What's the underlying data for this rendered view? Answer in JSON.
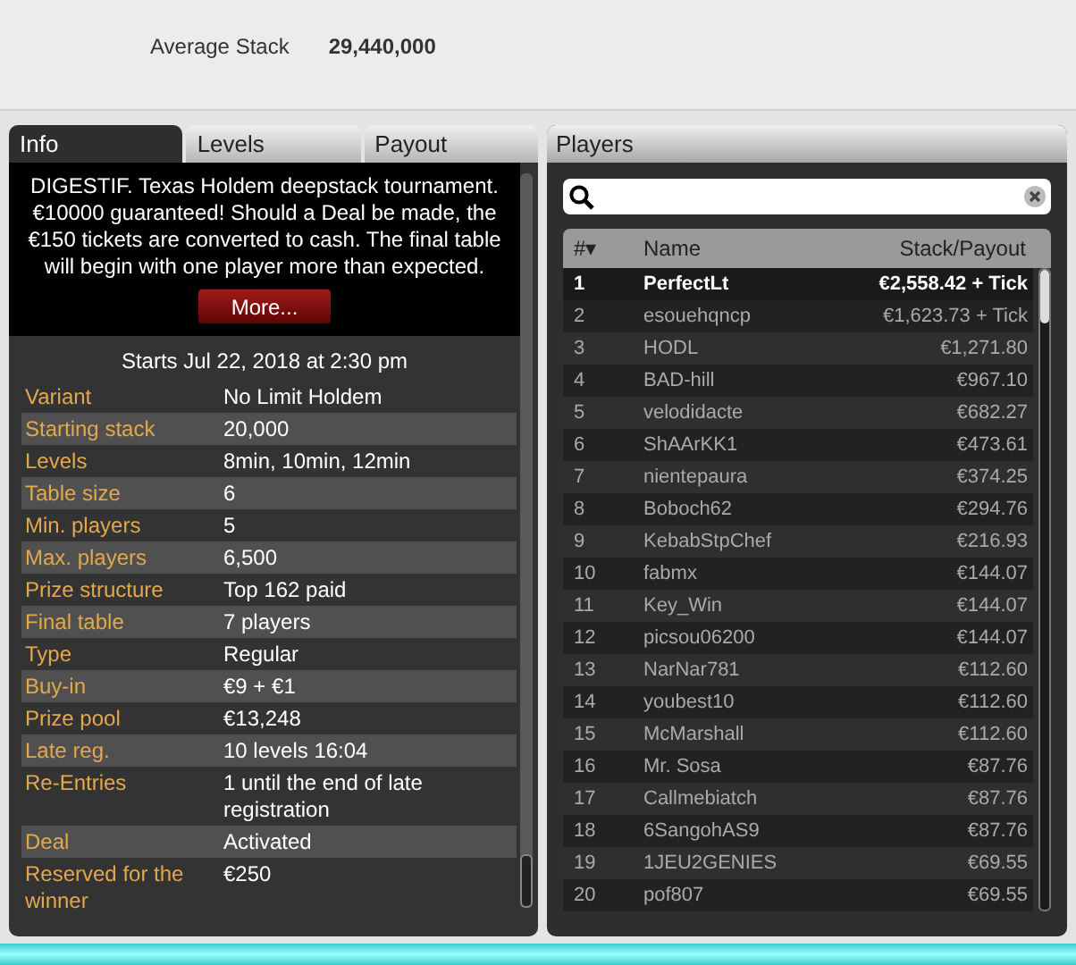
{
  "summary": {
    "label": "Average Stack",
    "value": "29,440,000"
  },
  "tabs": [
    {
      "label": "Info",
      "selected": true
    },
    {
      "label": "Levels",
      "selected": false
    },
    {
      "label": "Payout",
      "selected": false
    }
  ],
  "description": "DIGESTIF. Texas Holdem deepstack tournament. €10000 guaranteed! Should a Deal be made, the €150 tickets are converted to cash. The final table will begin with one player more than expected.",
  "more_button": "More...",
  "start": "Starts Jul 22, 2018 at 2:30 pm",
  "details": [
    {
      "label": "Variant",
      "value": "No Limit Holdem"
    },
    {
      "label": "Starting stack",
      "value": "20,000"
    },
    {
      "label": "Levels",
      "value": "8min, 10min, 12min"
    },
    {
      "label": "Table size",
      "value": "6"
    },
    {
      "label": "Min. players",
      "value": "5"
    },
    {
      "label": "Max. players",
      "value": "6,500"
    },
    {
      "label": "Prize structure",
      "value": "Top 162 paid"
    },
    {
      "label": "Final table",
      "value": "7 players"
    },
    {
      "label": "Type",
      "value": "Regular"
    },
    {
      "label": "Buy-in",
      "value": "€9 + €1"
    },
    {
      "label": "Prize pool",
      "value": "€13,248"
    },
    {
      "label": "Late reg.",
      "value": "10 levels 16:04"
    },
    {
      "label": "Re-Entries",
      "value": "1 until the end of late registration"
    },
    {
      "label": "Deal",
      "value": "Activated"
    },
    {
      "label": "Reserved for the winner",
      "value": "€250"
    }
  ],
  "players_panel": {
    "title": "Players",
    "columns": [
      "#▾",
      "Name",
      "Stack/Payout"
    ],
    "rows": [
      {
        "rank": "1",
        "name": "PerfectLt",
        "payout": "€2,558.42 +  Tick",
        "selected": true
      },
      {
        "rank": "2",
        "name": "esouehqncp",
        "payout": "€1,623.73 +  Tick",
        "selected": false
      },
      {
        "rank": "3",
        "name": "HODL",
        "payout": "€1,271.80",
        "selected": false
      },
      {
        "rank": "4",
        "name": "BAD-hill",
        "payout": "€967.10",
        "selected": false
      },
      {
        "rank": "5",
        "name": "velodidacte",
        "payout": "€682.27",
        "selected": false
      },
      {
        "rank": "6",
        "name": "ShAArKK1",
        "payout": "€473.61",
        "selected": false
      },
      {
        "rank": "7",
        "name": "nientepaura",
        "payout": "€374.25",
        "selected": false
      },
      {
        "rank": "8",
        "name": "Boboch62",
        "payout": "€294.76",
        "selected": false
      },
      {
        "rank": "9",
        "name": "KebabStpChef",
        "payout": "€216.93",
        "selected": false
      },
      {
        "rank": "10",
        "name": "fabmx",
        "payout": "€144.07",
        "selected": false
      },
      {
        "rank": "11",
        "name": "Key_Win",
        "payout": "€144.07",
        "selected": false
      },
      {
        "rank": "12",
        "name": "picsou06200",
        "payout": "€144.07",
        "selected": false
      },
      {
        "rank": "13",
        "name": "NarNar781",
        "payout": "€112.60",
        "selected": false
      },
      {
        "rank": "14",
        "name": "youbest10",
        "payout": "€112.60",
        "selected": false
      },
      {
        "rank": "15",
        "name": "McMarshall",
        "payout": "€112.60",
        "selected": false
      },
      {
        "rank": "16",
        "name": "Mr. Sosa",
        "payout": "€87.76",
        "selected": false
      },
      {
        "rank": "17",
        "name": "Callmebiatch",
        "payout": "€87.76",
        "selected": false
      },
      {
        "rank": "18",
        "name": "6SangohAS9",
        "payout": "€87.76",
        "selected": false
      },
      {
        "rank": "19",
        "name": "1JEU2GENIES",
        "payout": "€69.55",
        "selected": false
      },
      {
        "rank": "20",
        "name": "pof807",
        "payout": "€69.55",
        "selected": false
      }
    ]
  }
}
